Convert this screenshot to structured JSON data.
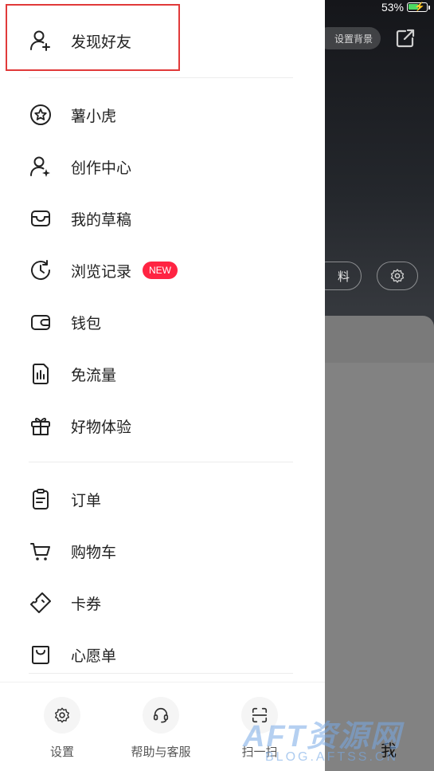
{
  "status_bar": {
    "battery": "53%"
  },
  "background": {
    "set_background_label": "设置背景",
    "edit_profile_label": "料",
    "tab_me_label": "我"
  },
  "drawer": {
    "find_friends": {
      "label": "发现好友",
      "icon": "add-user-icon"
    },
    "items": [
      {
        "label": "薯小虎",
        "icon": "star-circle-icon"
      },
      {
        "label": "创作中心",
        "icon": "creator-user-icon"
      },
      {
        "label": "我的草稿",
        "icon": "tray-icon"
      },
      {
        "label": "浏览记录",
        "icon": "history-clock-icon",
        "badge": "NEW"
      },
      {
        "label": "钱包",
        "icon": "wallet-icon"
      },
      {
        "label": "免流量",
        "icon": "data-sim-icon"
      },
      {
        "label": "好物体验",
        "icon": "gift-icon"
      },
      {
        "label": "订单",
        "icon": "clipboard-icon"
      },
      {
        "label": "购物车",
        "icon": "cart-icon"
      },
      {
        "label": "卡券",
        "icon": "ticket-icon"
      },
      {
        "label": "心愿单",
        "icon": "wish-bag-icon"
      }
    ],
    "bottom": [
      {
        "label": "设置",
        "icon": "gear-icon"
      },
      {
        "label": "帮助与客服",
        "icon": "headset-icon"
      },
      {
        "label": "扫一扫",
        "icon": "scan-icon"
      }
    ]
  },
  "watermark": {
    "main": "AFT资源网",
    "sub": "BLOG.AFTSS.CN"
  },
  "colors": {
    "badge": "#ff2442",
    "highlight": "#e13a3a"
  }
}
